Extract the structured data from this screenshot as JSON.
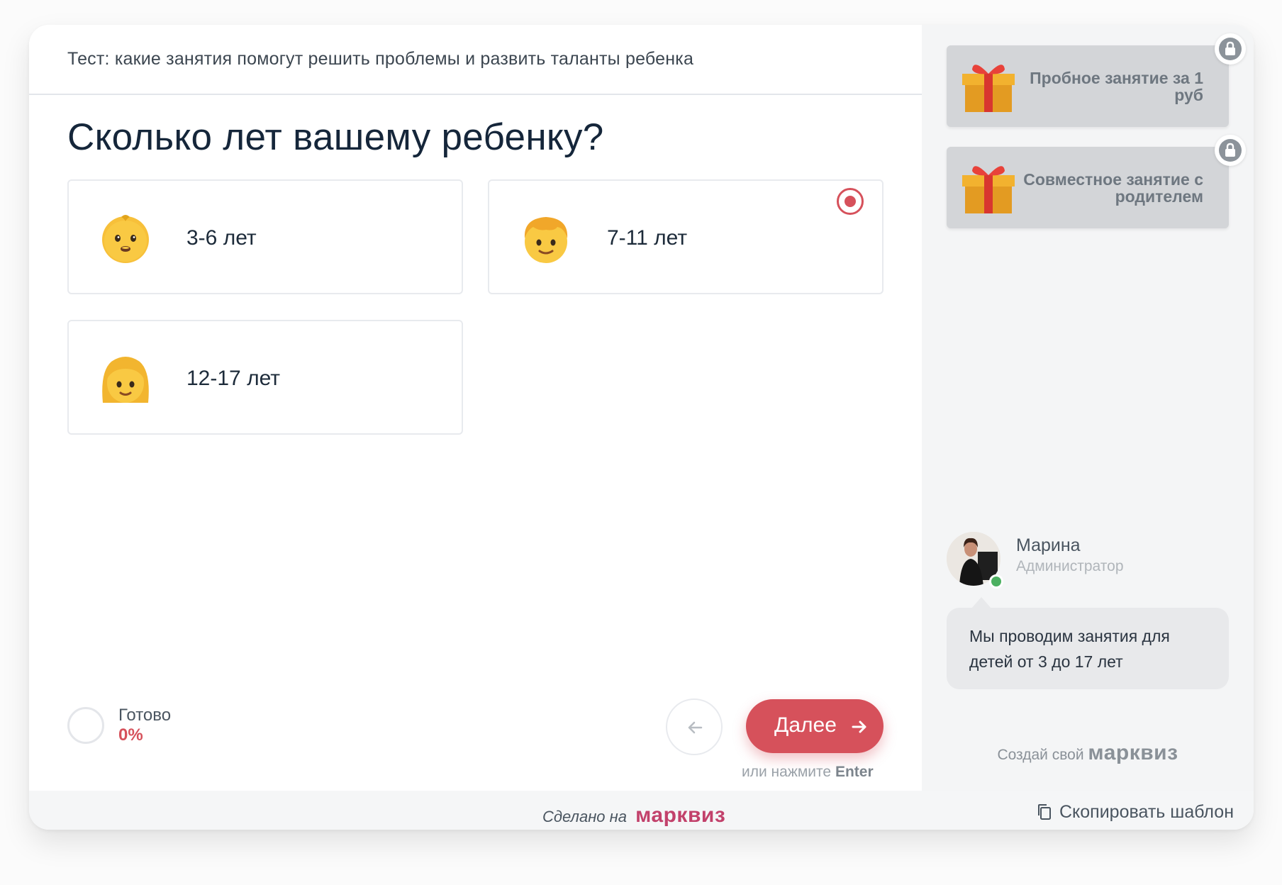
{
  "quiz": {
    "title": "Тест: какие занятия помогут решить проблемы и развить таланты ребенка",
    "question": "Сколько лет вашему ребенку?",
    "options": [
      {
        "label": "3-6 лет",
        "icon": "baby-emoji-icon",
        "selected": false
      },
      {
        "label": "7-11 лет",
        "icon": "boy-emoji-icon",
        "selected": true
      },
      {
        "label": "12-17 лет",
        "icon": "girl-emoji-icon",
        "selected": false
      }
    ]
  },
  "progress": {
    "label": "Готово",
    "value": "0%",
    "fraction": 0
  },
  "nav": {
    "next_label": "Далее",
    "hint_prefix": "или нажмите",
    "hint_key": "Enter"
  },
  "sidebar": {
    "bonuses": [
      {
        "text": "Пробное занятие за 1 руб",
        "icon": "gift-icon",
        "locked": true
      },
      {
        "text": "Совместное занятие с родителем",
        "icon": "gift-icon",
        "locked": true
      }
    ],
    "agent": {
      "name": "Марина",
      "role": "Администратор",
      "online": true,
      "message": "Мы проводим занятия для детей от 3 до 17 лет"
    },
    "brand_prefix": "Создай свой",
    "brand_logo": "марквиз"
  },
  "footer": {
    "made_on": "Сделано на",
    "logo": "марквиз",
    "copy_template": "Скопировать шаблон"
  },
  "colors": {
    "accent": "#d6515b",
    "brand": "#c2416b",
    "online": "#4cb061"
  }
}
